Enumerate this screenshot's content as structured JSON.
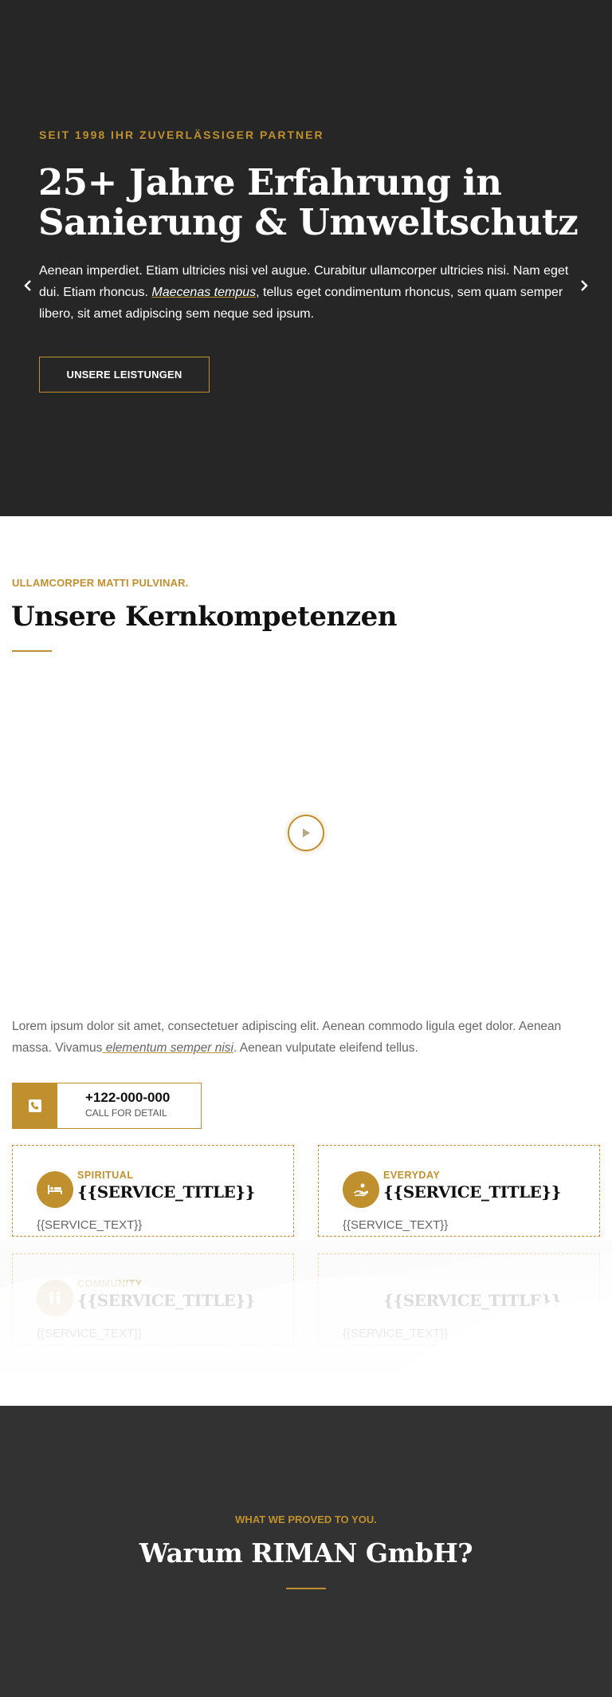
{
  "hero": {
    "eyebrow": "SEIT 1998 IHR ZUVERLÄSSIGER PARTNER",
    "title": "25+ Jahre Erfahrung in Sanierung & Umweltschutz",
    "text_before": "Aenean imperdiet. Etiam ultricies nisi vel augue. Curabitur ullamcorper ultricies nisi. Nam eget dui. Etiam rhoncus. ",
    "text_link": "Maecenas tempus",
    "text_after": ", tellus eget condimentum rhoncus, sem quam semper libero, sit amet adipiscing sem neque sed ipsum.",
    "button_label": "UNSERE LEISTUNGEN",
    "prev_icon": "chevron-left-icon",
    "next_icon": "chevron-right-icon"
  },
  "kern": {
    "eyebrow": "ULLAMCORPER MATTI PULVINAR.",
    "title": "Unsere Kernkompetenzen",
    "play_icon": "play-icon",
    "text_before": "Lorem ipsum dolor sit amet, consectetuer adipiscing elit. Aenean commodo ligula eget dolor. Aenean massa. Vivamus",
    "text_link": " elementum semper nisi",
    "text_after": ". Aenean vulputate eleifend tellus."
  },
  "phone": {
    "icon": "phone-icon",
    "number": "+122-000-000",
    "sub": "CALL FOR DETAIL"
  },
  "services": [
    {
      "icon": "bed-icon",
      "category": "SPIRITUAL",
      "title": "{{SERVICE_TITLE}}",
      "text": "{{SERVICE_TEXT}}"
    },
    {
      "icon": "hand-icon",
      "category": "EVERYDAY",
      "title": "{{SERVICE_TITLE}}",
      "text": "{{SERVICE_TEXT}}"
    },
    {
      "icon": "people-icon",
      "category": "COMMUNITY",
      "title": "{{SERVICE_TITLE}}",
      "text": "{{SERVICE_TEXT}}"
    },
    {
      "icon": "",
      "category": "",
      "title": "{{SERVICE_TITLE}}",
      "text": "{{SERVICE_TEXT}}"
    }
  ],
  "why": {
    "eyebrow": "WHAT WE PROVED TO YOU.",
    "title": "Warum RIMAN GmbH?"
  },
  "colors": {
    "accent": "#c0902f",
    "hero_bg": "#262626",
    "why_bg": "#323232"
  }
}
